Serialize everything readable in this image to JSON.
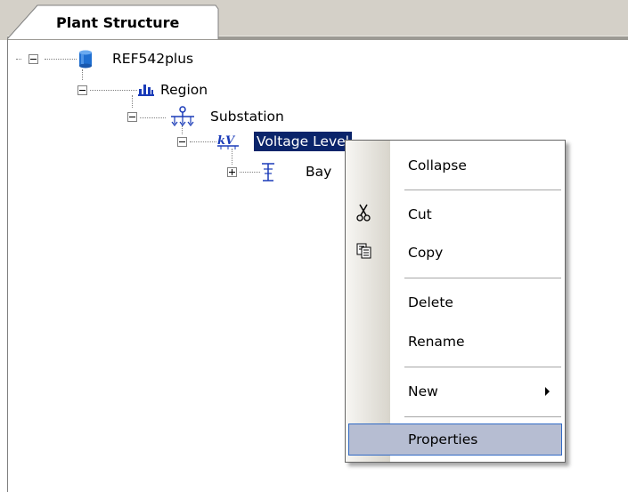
{
  "tab": {
    "label": "Plant Structure"
  },
  "tree": {
    "root": {
      "label": "REF542plus",
      "icon": "database-icon",
      "expanded": true
    },
    "region": {
      "label": "Region",
      "icon": "region-icon",
      "expanded": true
    },
    "substation": {
      "label": "Substation",
      "icon": "substation-icon",
      "expanded": true
    },
    "voltage_level": {
      "label": "Voltage Level",
      "icon": "voltage-level-icon",
      "expanded": true,
      "selected": true
    },
    "bay": {
      "label": "Bay",
      "icon": "bay-icon",
      "expanded": false
    }
  },
  "context_menu": {
    "collapse": "Collapse",
    "cut": "Cut",
    "copy": "Copy",
    "delete": "Delete",
    "rename": "Rename",
    "new": "New",
    "properties": "Properties"
  },
  "colors": {
    "selection": "#0a246a",
    "hover_fill": "#b6bdd2",
    "hover_border": "#316ac5",
    "tab_bar": "#d4d0c8"
  }
}
